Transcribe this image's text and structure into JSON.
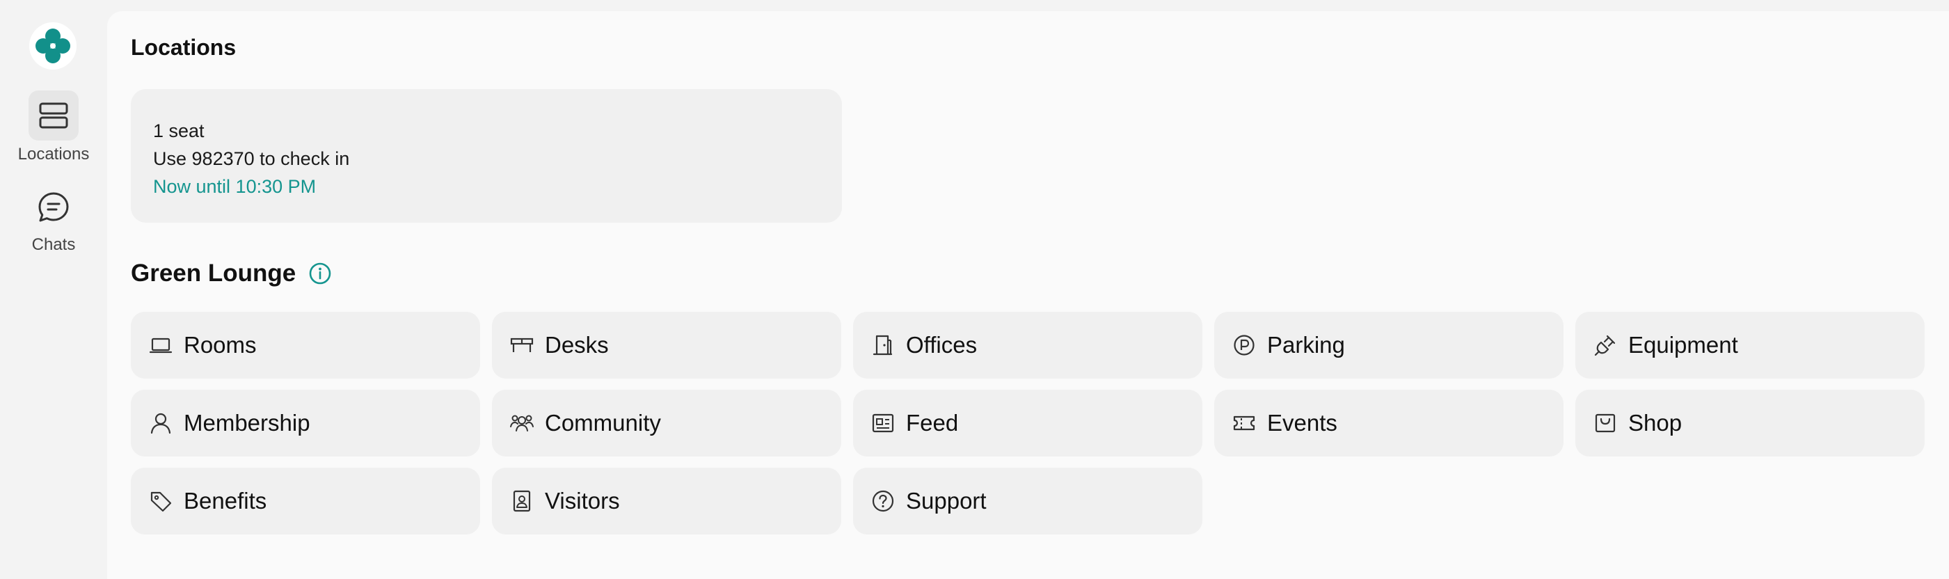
{
  "sidebar": {
    "logo_icon": "clover-logo-icon",
    "items": [
      {
        "label": "Locations",
        "icon": "server-stack-icon",
        "active": true
      },
      {
        "label": "Chats",
        "icon": "chat-bubble-icon",
        "active": false
      }
    ]
  },
  "page": {
    "title": "Locations"
  },
  "booking": {
    "seats": "1 seat",
    "checkin_prefix": "Use ",
    "checkin_code": "982370",
    "checkin_suffix": " to check in",
    "time": "Now until 10:30 PM"
  },
  "location": {
    "name": "Green Lounge",
    "info_icon": "info-circle-icon"
  },
  "tiles": [
    {
      "label": "Rooms",
      "icon": "laptop-icon"
    },
    {
      "label": "Desks",
      "icon": "desk-icon"
    },
    {
      "label": "Offices",
      "icon": "door-icon"
    },
    {
      "label": "Parking",
      "icon": "parking-icon"
    },
    {
      "label": "Equipment",
      "icon": "plug-icon"
    },
    {
      "label": "Membership",
      "icon": "person-icon"
    },
    {
      "label": "Community",
      "icon": "people-group-icon"
    },
    {
      "label": "Feed",
      "icon": "newspaper-icon"
    },
    {
      "label": "Events",
      "icon": "ticket-icon"
    },
    {
      "label": "Shop",
      "icon": "shopping-bag-icon"
    },
    {
      "label": "Benefits",
      "icon": "tag-icon"
    },
    {
      "label": "Visitors",
      "icon": "badge-icon"
    },
    {
      "label": "Support",
      "icon": "question-circle-icon"
    }
  ],
  "colors": {
    "accent": "#15958f",
    "background": "#f3f3f3",
    "panel": "#fafafa",
    "tile": "#f0f0f0"
  }
}
